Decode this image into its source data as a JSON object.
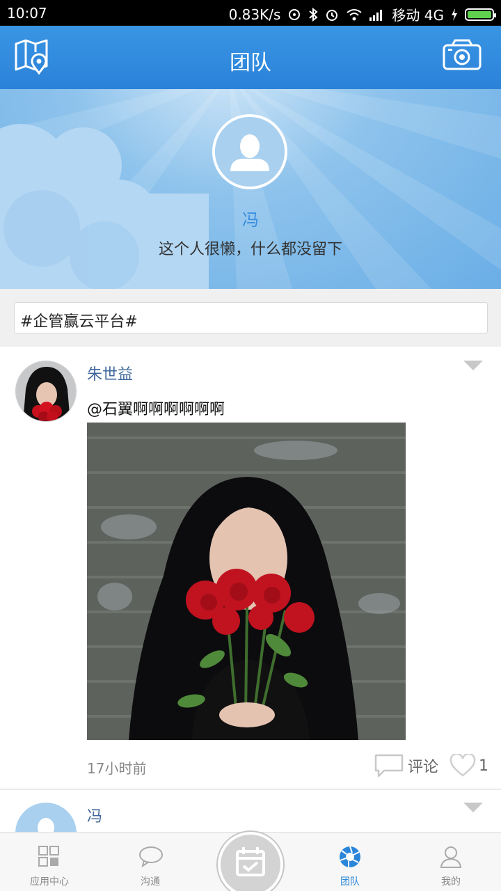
{
  "status_bar": {
    "time": "10:07",
    "net_speed": "0.83K/s",
    "carrier": "移动 4G"
  },
  "app_bar": {
    "title": "团队",
    "left_icon": "map-location-icon",
    "right_icon": "camera-icon"
  },
  "profile": {
    "name": "冯",
    "bio": "这个人很懒，什么都没留下"
  },
  "topic": {
    "text": "#企管赢云平台#"
  },
  "posts": [
    {
      "author": "朱世益",
      "text": "@石翼啊啊啊啊啊啊",
      "time": "17小时前",
      "comment_label": "评论",
      "like_count": "1"
    },
    {
      "author": "冯"
    }
  ],
  "bottom_nav": {
    "items": [
      {
        "label": "应用中心",
        "icon": "grid-icon"
      },
      {
        "label": "沟通",
        "icon": "chat-bubble-icon"
      },
      {
        "label": "团队",
        "icon": "aperture-icon",
        "active": true
      },
      {
        "label": "我的",
        "icon": "person-icon"
      }
    ],
    "center_icon": "calendar-check-icon"
  },
  "colors": {
    "accent": "#2a86d9",
    "author_name": "#40689d",
    "battery": "#5fd14f"
  }
}
